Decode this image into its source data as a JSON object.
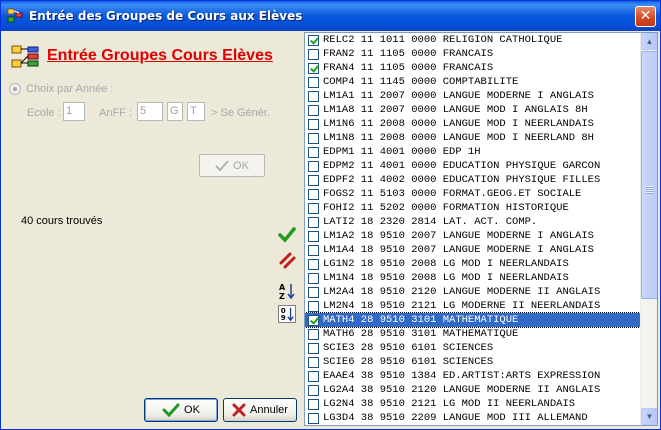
{
  "window": {
    "title": "Entrée des Groupes de Cours aux Elèves",
    "close_glyph": "✕"
  },
  "form": {
    "title": "Entrée Groupes Cours Elèves",
    "radio_label": "Choix par Année :",
    "ecole_label": "Ecole :",
    "ecole_value": "1",
    "anff_label": "AnFF :",
    "anff_value": "5",
    "g_value": "G",
    "t_value": "T",
    "se_gener_label": "> Se Génér.",
    "ok_small_label": "OK",
    "count_label": "40 cours trouvés",
    "ok_label": "OK",
    "cancel_label": "Annuler"
  },
  "icons": {
    "check": "check-icon",
    "cancel": "cancel-icon",
    "sort_alpha": "sort-alpha-icon",
    "sort_num": "sort-numeric-icon"
  },
  "colors": {
    "title_red": "#E00000",
    "selection": "#316AC5",
    "check_green": "#21A121"
  },
  "courses": [
    {
      "text": "RELC2 11 1011 0000 RELIGION CATHOLIQUE",
      "checked": true,
      "selected": false
    },
    {
      "text": "FRAN2 11 1105 0000 FRANCAIS",
      "checked": false,
      "selected": false
    },
    {
      "text": "FRAN4 11 1105 0000 FRANCAIS",
      "checked": true,
      "selected": false
    },
    {
      "text": "COMP4 11 1145 0000 COMPTABILITE",
      "checked": false,
      "selected": false
    },
    {
      "text": "LM1A1 11 2007 0000 LANGUE MODERNE I ANGLAIS",
      "checked": false,
      "selected": false
    },
    {
      "text": "LM1A8 11 2007 0000 LANGUE MOD I ANGLAIS 8H",
      "checked": false,
      "selected": false
    },
    {
      "text": "LM1N6 11 2008 0000 LANGUE MOD I NEERLANDAIS",
      "checked": false,
      "selected": false
    },
    {
      "text": "LM1N8 11 2008 0000 LANGUE MOD I NEERLAND 8H",
      "checked": false,
      "selected": false
    },
    {
      "text": "EDPM1 11 4001 0000 EDP 1H",
      "checked": false,
      "selected": false
    },
    {
      "text": "EDPM2 11 4001 0000 EDUCATION PHYSIQUE GARCON",
      "checked": false,
      "selected": false
    },
    {
      "text": "EDPF2 11 4002 0000 EDUCATION PHYSIQUE FILLES",
      "checked": false,
      "selected": false
    },
    {
      "text": "FOGS2 11 5103 0000 FORMAT.GEOG.ET SOCIALE",
      "checked": false,
      "selected": false
    },
    {
      "text": "FOHI2 11 5202 0000 FORMATION HISTORIQUE",
      "checked": false,
      "selected": false
    },
    {
      "text": "LATI2 18 2320 2814 LAT. ACT. COMP.",
      "checked": false,
      "selected": false
    },
    {
      "text": "LM1A2 18 9510 2007 LANGUE MODERNE I ANGLAIS",
      "checked": false,
      "selected": false
    },
    {
      "text": "LM1A4 18 9510 2007 LANGUE MODERNE I ANGLAIS",
      "checked": false,
      "selected": false
    },
    {
      "text": "LG1N2 18 9510 2008 LG MOD I NEERLANDAIS",
      "checked": false,
      "selected": false
    },
    {
      "text": "LM1N4 18 9510 2008 LG MOD I NEERLANDAIS",
      "checked": false,
      "selected": false
    },
    {
      "text": "LM2A4 18 9510 2120 LANGUE MODERNE II ANGLAIS",
      "checked": false,
      "selected": false
    },
    {
      "text": "LM2N4 18 9510 2121 LG MODERNE II NEERLANDAIS",
      "checked": false,
      "selected": false
    },
    {
      "text": "MATH4 28 9510 3101 MATHEMATIQUE",
      "checked": true,
      "selected": true
    },
    {
      "text": "MATH6 28 9510 3101 MATHEMATIQUE",
      "checked": false,
      "selected": false
    },
    {
      "text": "SCIE3 28 9510 6101 SCIENCES",
      "checked": false,
      "selected": false
    },
    {
      "text": "SCIE6 28 9510 6101 SCIENCES",
      "checked": false,
      "selected": false
    },
    {
      "text": "EAAE4 38 9510 1384 ED.ARTIST:ARTS EXPRESSION",
      "checked": false,
      "selected": false
    },
    {
      "text": "LG2A4 38 9510 2120 LANGUE MODERNE II ANGLAIS",
      "checked": false,
      "selected": false
    },
    {
      "text": "LG2N4 38 9510 2121 LG MOD II NEERLANDAIS",
      "checked": false,
      "selected": false
    },
    {
      "text": "LG3D4 38 9510 2209 LANGUE MOD III ALLEMAND",
      "checked": false,
      "selected": false
    }
  ]
}
